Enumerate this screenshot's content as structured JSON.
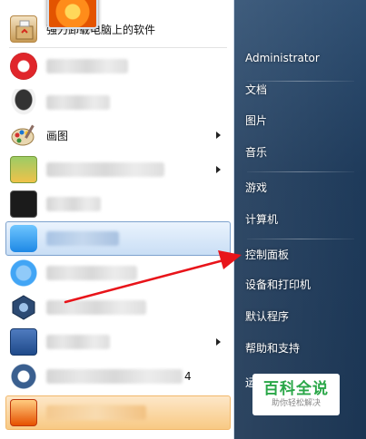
{
  "programs": [
    {
      "label": "强力卸载电脑上的软件",
      "icon": "uninstall-box-icon"
    },
    {
      "label": "",
      "icon": "red-circle-app-icon"
    },
    {
      "label": "",
      "icon": "penguin-icon"
    },
    {
      "label": "画图",
      "icon": "paint-palette-icon"
    },
    {
      "label": "",
      "icon": "folder-app-icon"
    },
    {
      "label": "",
      "icon": "terminal-icon"
    },
    {
      "label": "",
      "icon": "blue-app-icon"
    },
    {
      "label": "",
      "icon": "blue-circle-app-icon"
    },
    {
      "label": "",
      "icon": "hexagon-app-icon"
    },
    {
      "label": "",
      "icon": "blue-box-app-icon"
    },
    {
      "label": "4",
      "icon": "c-app-icon"
    },
    {
      "label": "",
      "icon": "pdf-icon"
    }
  ],
  "right_menu": {
    "username": "Administrator",
    "items": [
      "文档",
      "图片",
      "音乐",
      "游戏",
      "计算机",
      "控制面板",
      "设备和打印机",
      "默认程序",
      "帮助和支持"
    ],
    "partial_item": "运"
  },
  "watermark": {
    "title": "百科全说",
    "subtitle": "助你轻松解决"
  },
  "colors": {
    "right_pane": "#1e3a5a",
    "arrow": "#e8141a",
    "highlight": "#c9def5",
    "recent": "#f8c983",
    "watermark_green": "#2aa748"
  }
}
